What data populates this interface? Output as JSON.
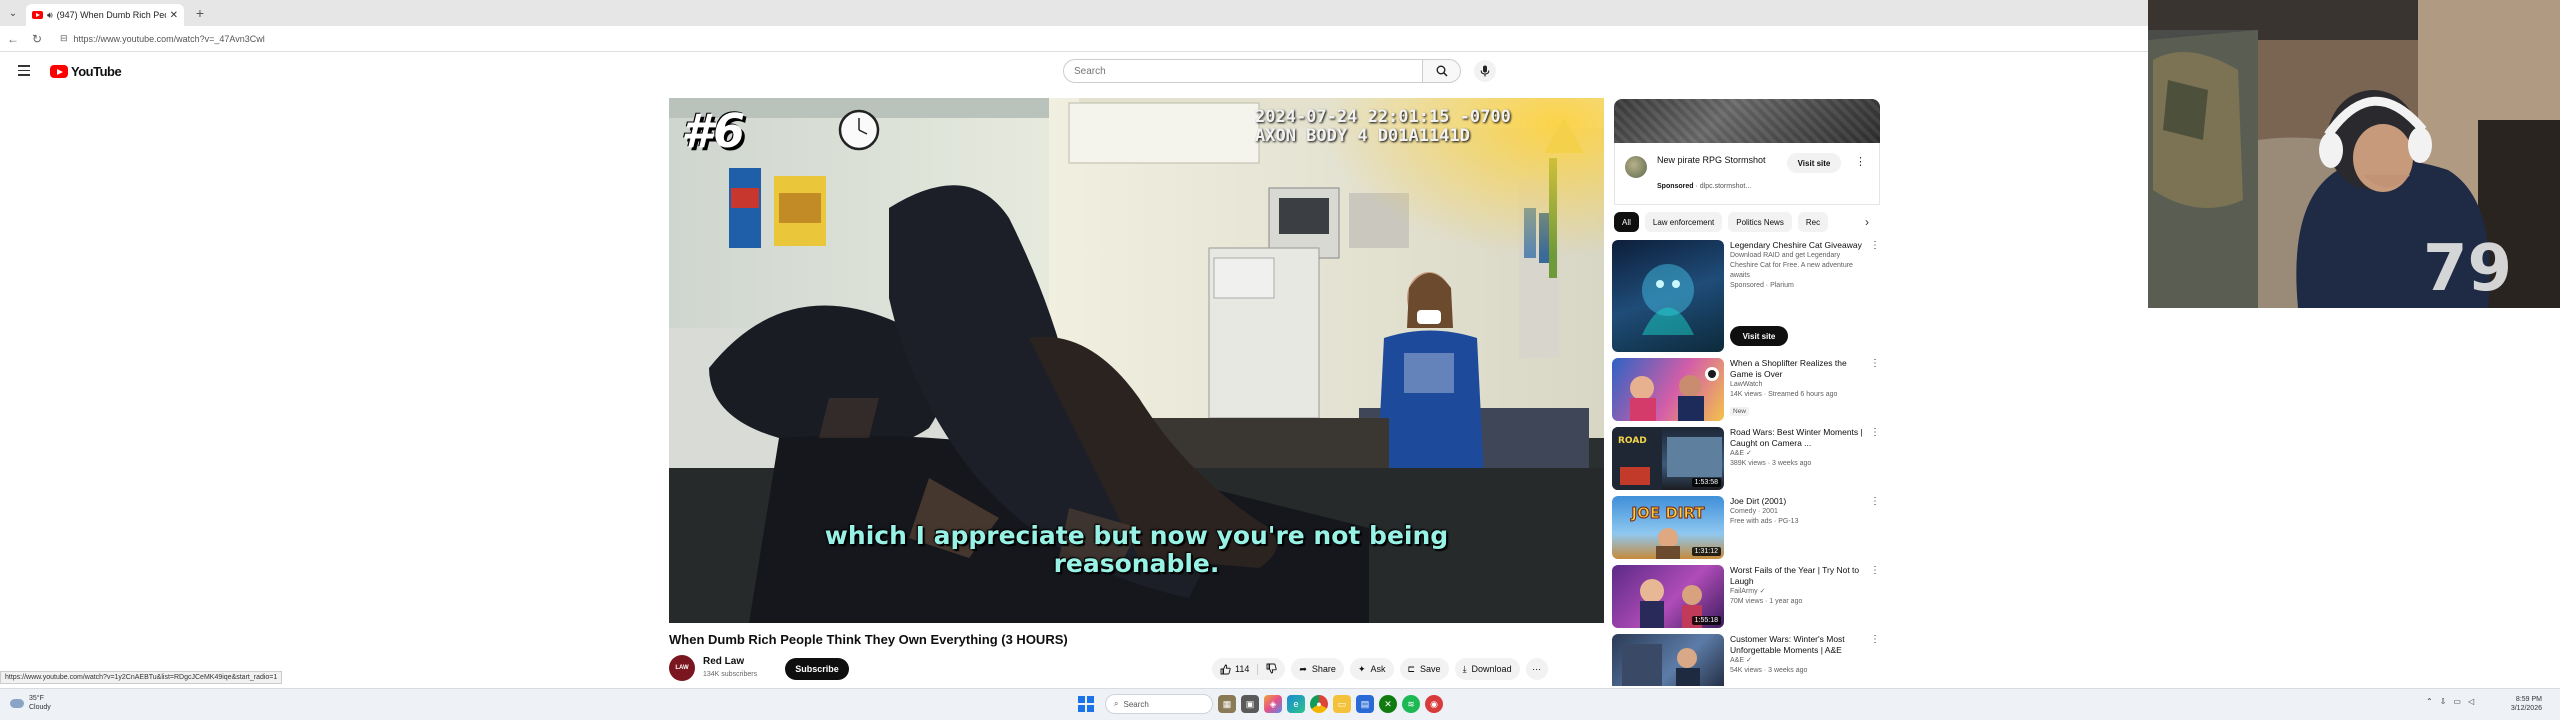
{
  "browser": {
    "tab_title": "(947) When Dumb Rich Peopl",
    "new_tab_symbol": "+",
    "url": "https://www.youtube.com/watch?v=_47Avn3Cwl"
  },
  "masthead": {
    "logo_text": "YouTube",
    "search_placeholder": "Search"
  },
  "video": {
    "rank": "#6",
    "timestamp_line1": "2024-07-24 22:01:15 -0700",
    "timestamp_line2": "AXON BODY 4 D01A1141D",
    "caption_line1": "which I appreciate but now you're not being",
    "caption_line2": "reasonable.",
    "title": "When Dumb Rich People Think They Own Everything (3 HOURS)",
    "channel": "Red Law",
    "channel_avatar_text": "LAW",
    "subscribers": "134K subscribers",
    "subscribe_label": "Subscribe",
    "likes": "114",
    "share_label": "Share",
    "ask_label": "Ask",
    "save_label": "Save",
    "download_label": "Download"
  },
  "sidebar": {
    "ad": {
      "title": "New pirate RPG Stormshot",
      "sponsored": "Sponsored",
      "domain": "dlpc.stormshot...",
      "visit_label": "Visit site"
    },
    "chips": [
      "All",
      "Law enforcement",
      "Politics News",
      "Rec"
    ],
    "recommendations": [
      {
        "title": "Legendary Cheshire Cat Giveaway",
        "channel": "Download RAID and get Legendary Cheshire Cat for Free. A new adventure awaits",
        "meta": "Sponsored · Plarium",
        "badge": "",
        "duration": "",
        "visit_label": "Visit site"
      },
      {
        "title": "When a Shoplifter Realizes the Game is Over",
        "channel": "LawWatch",
        "meta": "14K views · Streamed 6 hours ago",
        "badge": "New",
        "duration": ""
      },
      {
        "title": "Road Wars: Best Winter Moments | Caught on Camera ...",
        "channel": "A&E",
        "meta": "389K views · 3 weeks ago",
        "badge": "",
        "duration": "1:53:58"
      },
      {
        "title": "Joe Dirt (2001)",
        "channel": "Comedy · 2001",
        "meta": "Free with ads · PG-13",
        "badge": "",
        "duration": "1:31:12",
        "thumb_text": "JOE DIRT"
      },
      {
        "title": "Worst Fails of the Year | Try Not to Laugh",
        "channel": "FailArmy",
        "meta": "70M views · 1 year ago",
        "badge": "",
        "duration": "1:55:18"
      },
      {
        "title": "Customer Wars: Winter's Most Unforgettable Moments | A&E",
        "channel": "A&E",
        "meta": "54K views · 3 weeks ago",
        "badge": "",
        "duration": ""
      }
    ]
  },
  "status_bar_url": "https://www.youtube.com/watch?v=1y2CnAEBTu&list=RDgcJCeMK49iqe&start_radio=1",
  "taskbar": {
    "weather_temp": "35°F",
    "weather_desc": "Cloudy",
    "search_placeholder": "Search",
    "time": "8:59 PM",
    "date": "3/12/2026"
  },
  "icons": {
    "menu": "hamburger-icon",
    "search": "search-icon",
    "mic": "microphone-icon",
    "like": "thumbs-up-icon",
    "dislike": "thumbs-down-icon",
    "share": "share-icon",
    "ask": "sparkle-icon",
    "save": "bookmark-icon",
    "download": "download-icon",
    "more": "more-vert-icon"
  },
  "colors": {
    "brand_red": "#ff0000",
    "caption_color": "#98f2e6",
    "subscribe_bg": "#0f0f0f"
  }
}
